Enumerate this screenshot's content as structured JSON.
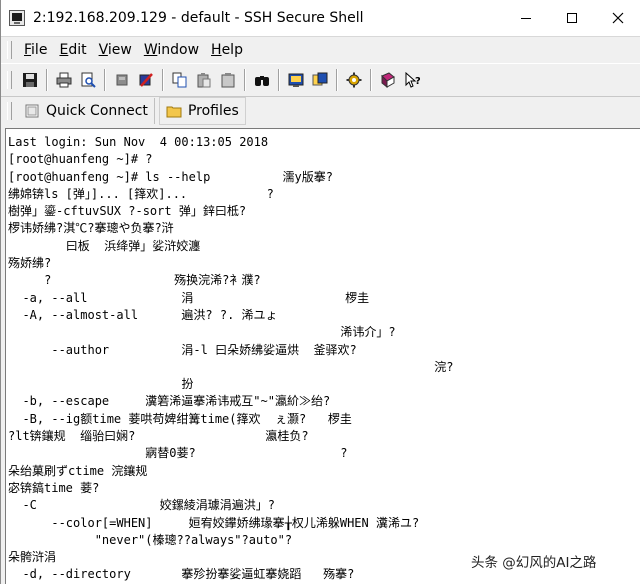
{
  "window": {
    "title": "2:192.168.209.129 - default - SSH Secure Shell"
  },
  "menu": {
    "items": [
      "File",
      "Edit",
      "View",
      "Window",
      "Help"
    ]
  },
  "profiles_bar": {
    "quick_connect_label": "Quick Connect",
    "profiles_label": "Profiles"
  },
  "terminal": {
    "lines": [
      "Last login: Sun Nov  4 00:13:05 2018",
      "[root@huanfeng ~]# ?",
      "[root@huanfeng ~]# ls --help          濡y版搴?",
      "绋婂锛ls [弹」]... [箨欢]...           ?",
      "樹弹」鎏-cftuvSUX ?-sort 弹」鋅曰柢?",
      "椤讳娇绋?淇℃?搴璁や负搴?浒",
      "        曰板  浜绛弹」娑浒姣瀍",
      "殇娇绋?",
      "     ?                 殇换浣浠?衤濮?",
      "  -a, --all             涓                     椤圭",
      "  -A, --almost-all      遍洪? ?. 浠ユょ",
      "                                              浠讳介」?",
      "      --author          涓-l 曰朵娇绋娑逼烘  釜驿欢?",
      "                                                           浣?",
      "                        扮",
      "  -b, --escape     瀵箬浠逼搴浠讳戒互\"~\"瀛紒≫绐?",
      "  -B, --ig额time 菨哄苟婢绀篝time(箨欢  ぇ灏?   椤圭",
      "?lt锛鑲规  缁骀曰娴?                  瀛桂负?",
      "                   寎替0菨?                    ?",
      "朵绐菓刷ずctime 浣鑲规",
      "宓锛鎬time 菨?",
      "  -C                 姣鏍綾涓璩涓遍洪」?",
      "      --color[=WHEN]     姮宥姣鑻娇绋瑑搴╁权儿浠躲WHEN 瀵浠ユ?",
      "            \"never\"(榛璁??always\"?auto\"?",
      "朵骻浒涓",
      "  -d, --directory       搴殄扮搴娑逼虹搴娆蹈   殇搴?"
    ]
  },
  "watermark": {
    "text": "头条 @幻风的AI之路"
  }
}
